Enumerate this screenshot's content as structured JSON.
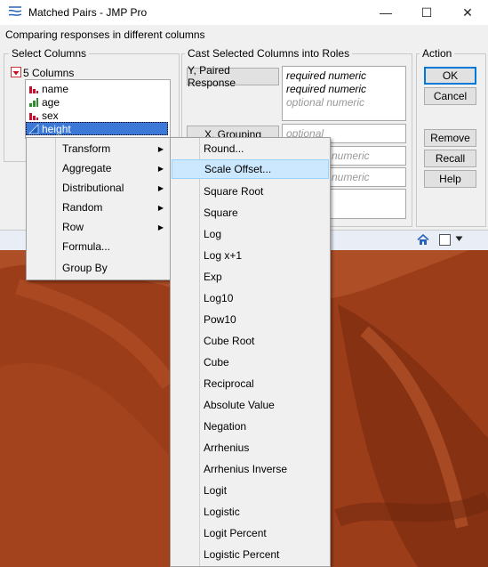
{
  "window": {
    "title": "Matched Pairs - JMP Pro",
    "minimize": "—",
    "maximize": "☐",
    "close": "✕",
    "subtitle": "Comparing responses in different columns"
  },
  "select_columns": {
    "label": "Select Columns",
    "count_label": "5 Columns",
    "items": [
      {
        "label": "name",
        "icon": "nominal-column-icon"
      },
      {
        "label": "age",
        "icon": "ordinal-column-icon"
      },
      {
        "label": "sex",
        "icon": "nominal-column-icon"
      },
      {
        "label": "height",
        "icon": "continuous-column-icon"
      }
    ]
  },
  "cast_roles": {
    "label": "Cast Selected Columns into Roles",
    "y_button": "Y, Paired Response",
    "y_lines": [
      "required numeric",
      "required numeric",
      "optional numeric"
    ],
    "x_button": "X, Grouping",
    "x_line": "optional",
    "role3_line": "numeric",
    "role4_line": "numeric"
  },
  "action": {
    "label": "Action",
    "ok": "OK",
    "cancel": "Cancel",
    "remove": "Remove",
    "recall": "Recall",
    "help": "Help"
  },
  "context_menu": {
    "items": [
      {
        "label": "Transform",
        "submenu": true
      },
      {
        "label": "Aggregate",
        "submenu": true
      },
      {
        "label": "Distributional",
        "submenu": true
      },
      {
        "label": "Random",
        "submenu": true
      },
      {
        "label": "Row",
        "submenu": true
      },
      {
        "label": "Formula...",
        "submenu": false
      },
      {
        "label": "Group By",
        "submenu": false
      }
    ]
  },
  "transform_menu": {
    "highlighted": "Scale Offset...",
    "items": [
      "Round...",
      "Scale Offset...",
      "Square Root",
      "Square",
      "Log",
      "Log x+1",
      "Exp",
      "Log10",
      "Pow10",
      "Cube Root",
      "Cube",
      "Reciprocal",
      "Absolute Value",
      "Negation",
      "Arrhenius",
      "Arrhenius Inverse",
      "Logit",
      "Logistic",
      "Logit Percent",
      "Logistic Percent"
    ]
  },
  "colors": {
    "accent": "#0078d7",
    "selection": "#3b78d8",
    "menu_highlight": "#cce8ff"
  }
}
